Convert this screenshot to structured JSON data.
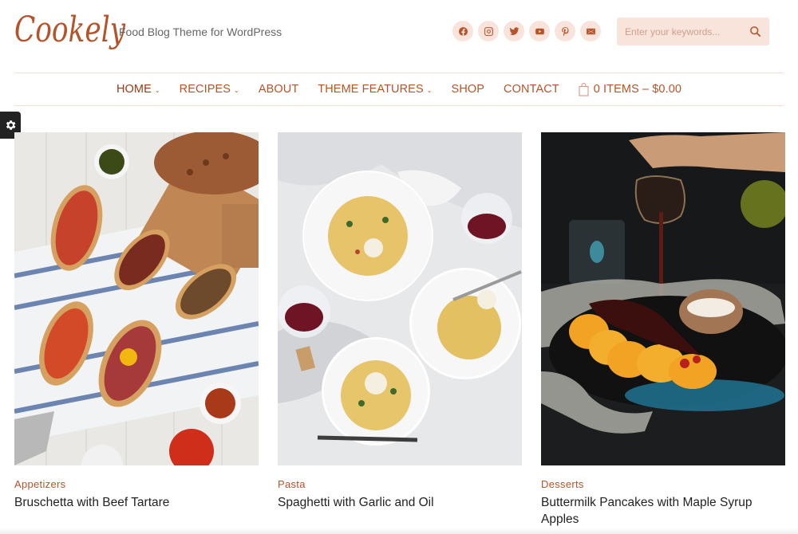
{
  "site": {
    "logo": "Cookely",
    "tagline": "Food Blog Theme for WordPress"
  },
  "socials": [
    {
      "name": "facebook-icon"
    },
    {
      "name": "instagram-icon"
    },
    {
      "name": "twitter-icon"
    },
    {
      "name": "youtube-icon"
    },
    {
      "name": "pinterest-icon"
    },
    {
      "name": "email-icon"
    }
  ],
  "search": {
    "placeholder": "Enter your keywords...",
    "value": ""
  },
  "nav": {
    "items": [
      {
        "label": "HOME",
        "dropdown": true,
        "active": true
      },
      {
        "label": "RECIPES",
        "dropdown": true
      },
      {
        "label": "ABOUT",
        "dropdown": false
      },
      {
        "label": "THEME FEATURES",
        "dropdown": true
      },
      {
        "label": "SHOP",
        "dropdown": false
      },
      {
        "label": "CONTACT",
        "dropdown": false
      }
    ],
    "cart_label": "0 ITEMS – $0.00"
  },
  "colors": {
    "accent": "#b5532a",
    "accent_light": "#f9e4dc"
  },
  "posts": [
    {
      "category": "Appetizers",
      "title": "Bruschetta with Beef Tartare",
      "image": "bruschetta-photo"
    },
    {
      "category": "Pasta",
      "title": "Spaghetti with Garlic and Oil",
      "image": "spaghetti-photo"
    },
    {
      "category": "Desserts",
      "title": "Buttermilk Pancakes with Maple Syrup Apples",
      "image": "pancakes-photo"
    }
  ]
}
